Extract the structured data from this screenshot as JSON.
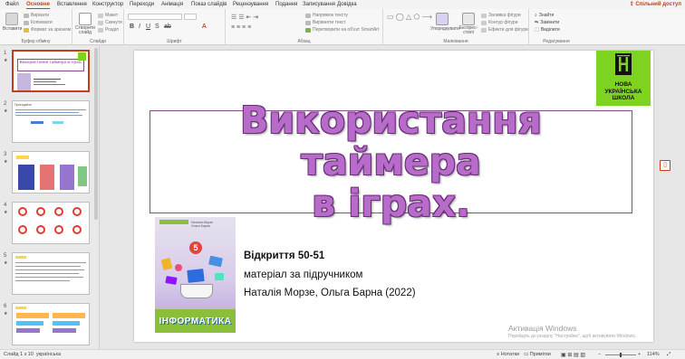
{
  "menu": {
    "tabs": [
      "Файл",
      "Основне",
      "Вставлення",
      "Конструктор",
      "Переходи",
      "Анімація",
      "Показ слайдів",
      "Рецензування",
      "Подання",
      "Записування",
      "Довідка"
    ],
    "active_index": 1,
    "share_label": "Спільний доступ"
  },
  "ribbon": {
    "clipboard": {
      "label": "Буфер обміну",
      "paste": "Вставити",
      "cut": "Вирізати",
      "copy": "Копіювати",
      "format_painter": "Формат за зразком"
    },
    "slides": {
      "label": "Слайди",
      "new_slide": "Створити слайд",
      "layout": "Макет",
      "reset": "Скинути",
      "section": "Розділ"
    },
    "font": {
      "label": "Шрифт"
    },
    "paragraph": {
      "label": "Абзац",
      "text_direction": "Напрямок тексту",
      "align_text": "Вирівняти текст",
      "smartart": "Перетворити на об'єкт SmartArt"
    },
    "drawing": {
      "label": "Малювання",
      "arrange": "Упорядкувати",
      "quick_styles": "Експрес-стилі",
      "shape_fill": "Заливка фігури",
      "shape_outline": "Контур фігури",
      "shape_effects": "Ефекти для фігури"
    },
    "editing": {
      "label": "Редагування",
      "find": "Знайти",
      "replace": "Замінити",
      "select": "Виділити"
    }
  },
  "thumbnails": {
    "numbers": [
      "1",
      "2",
      "3",
      "4",
      "5",
      "6"
    ],
    "slide1_title": "Використання таймера в іграх.",
    "slide2_title": "Пригадайте"
  },
  "slide": {
    "logo": {
      "line1": "НОВА",
      "line2": "УКРАЇНСЬКА",
      "line3": "ШКОЛА"
    },
    "title_line1": "Використання таймера",
    "title_line2": "в іграх.",
    "book": {
      "band": "ІНФОРМАТИКА",
      "grade": "5",
      "authors": "Наталія Морзе\nОльга Барна"
    },
    "info_line1": "Відкриття 50-51",
    "info_line2": "матеріал за підручником",
    "info_line3": "Наталія Морзе, Ольга Барна (2022)"
  },
  "watermark": {
    "line1": "Активація Windows",
    "line2": "Перейдіть до розділу \"Настройки\", щоб активувати Windows."
  },
  "status": {
    "slide_counter": "Слайд 1 з 10",
    "language": "українська",
    "notes": "Нотатки",
    "zoom": "114%"
  },
  "colors": {
    "accent": "#c43e1c",
    "title_fill": "#b86cc9",
    "logo_green": "#7ed321"
  }
}
